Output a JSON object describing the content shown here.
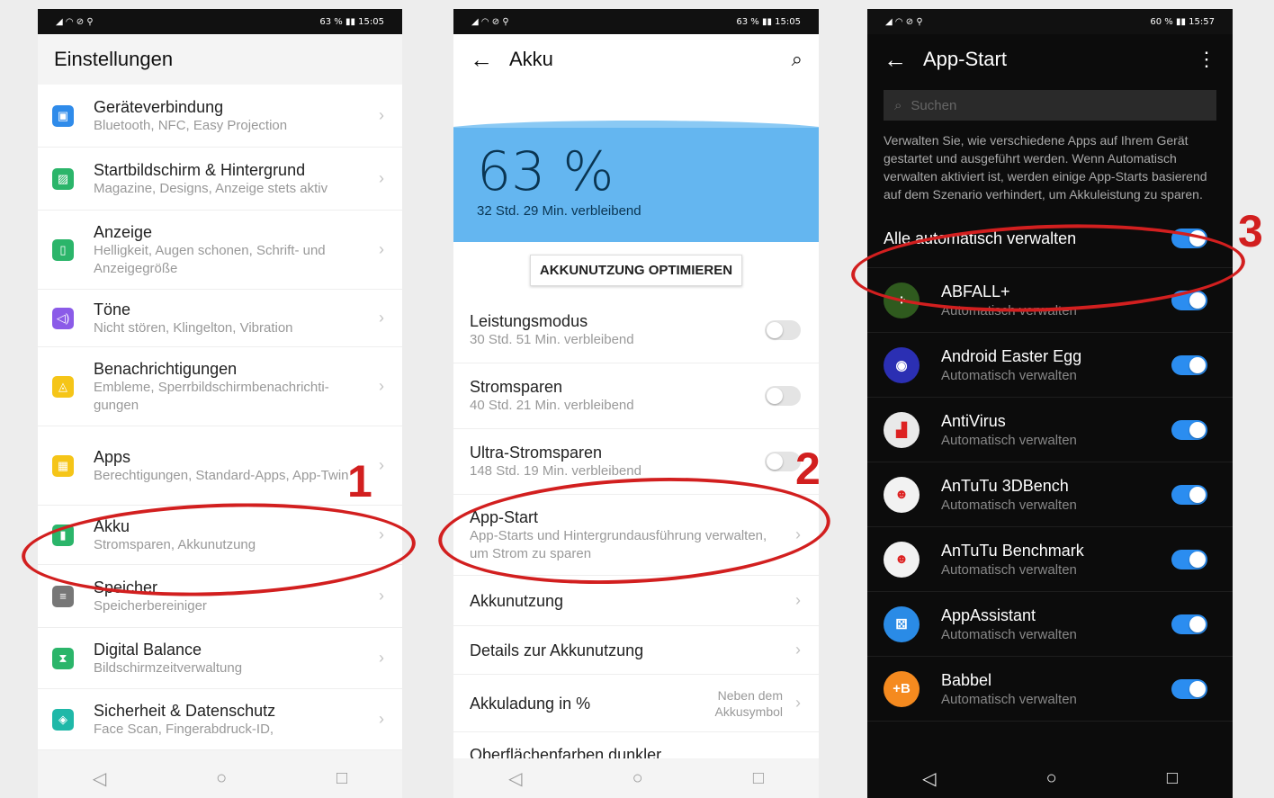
{
  "phone1": {
    "status_left": "◢ ◠ ⊘ ⚲",
    "status_right": "63 % ▮▮ 15:05",
    "title": "Einstellungen",
    "items": [
      {
        "icon": "device-connection-icon",
        "color": "#2f8bea",
        "glyph": "▣",
        "title": "Geräteverbindung",
        "subtitle": "Bluetooth, NFC, Easy Projection"
      },
      {
        "icon": "home-screen-icon",
        "color": "#2bb56a",
        "glyph": "▨",
        "title": "Startbildschirm & Hintergrund",
        "subtitle": "Magazine, Designs, Anzeige stets aktiv"
      },
      {
        "icon": "display-icon",
        "color": "#2bb56a",
        "glyph": "▯",
        "title": "Anzeige",
        "subtitle": "Helligkeit, Augen schonen, Schrift- und Anzeigegröße"
      },
      {
        "icon": "sound-icon",
        "color": "#8b5be8",
        "glyph": "◁)",
        "title": "Töne",
        "subtitle": "Nicht stören, Klingelton, Vibration"
      },
      {
        "icon": "notifications-icon",
        "color": "#f5c518",
        "glyph": "◬",
        "title": "Benachrichtigungen",
        "subtitle": "Embleme, Sperrbildschirmbenachrichti-gungen"
      },
      {
        "icon": "apps-icon",
        "color": "#f5c518",
        "glyph": "▦",
        "title": "Apps",
        "subtitle": "Berechtigungen, Standard-Apps, App-Twin"
      },
      {
        "icon": "battery-icon",
        "color": "#2bb56a",
        "glyph": "▮",
        "title": "Akku",
        "subtitle": "Stromsparen, Akkunutzung"
      },
      {
        "icon": "storage-icon",
        "color": "#777777",
        "glyph": "≡",
        "title": "Speicher",
        "subtitle": "Speicherbereiniger"
      },
      {
        "icon": "digital-balance-icon",
        "color": "#2bb56a",
        "glyph": "⧗",
        "title": "Digital Balance",
        "subtitle": "Bildschirmzeitverwaltung"
      },
      {
        "icon": "security-icon",
        "color": "#1fb8a8",
        "glyph": "◈",
        "title": "Sicherheit & Datenschutz",
        "subtitle": "Face Scan, Fingerabdruck-ID,"
      }
    ],
    "annotation": "1"
  },
  "phone2": {
    "status_left": "◢ ◠ ⊘ ⚲",
    "status_right": "63 % ▮▮ 15:05",
    "title": "Akku",
    "battery_percent": "63 %",
    "remaining": "32 Std. 29 Min. verbleibend",
    "optimize_button": "AKKUNUTZUNG OPTIMIEREN",
    "modes": [
      {
        "title": "Leistungsmodus",
        "subtitle": "30 Std. 51 Min. verbleibend",
        "on": false
      },
      {
        "title": "Stromsparen",
        "subtitle": "40 Std. 21 Min. verbleibend",
        "on": false
      },
      {
        "title": "Ultra-Stromsparen",
        "subtitle": "148 Std. 19 Min. verbleibend",
        "on": false
      }
    ],
    "app_start": {
      "title": "App-Start",
      "subtitle": "App-Starts und Hintergrundausführung verwalten, um Strom zu sparen"
    },
    "usage": "Akkunutzung",
    "usage_details": "Details zur Akkunutzung",
    "charge_pct": {
      "title": "Akkuladung in %",
      "value": "Neben dem Akkusymbol"
    },
    "dark_colors": "Oberflächenfarben dunkler",
    "annotation": "2"
  },
  "phone3": {
    "status_left": "◢ ◠ ⊘ ⚲",
    "status_right": "60 % ▮▮ 15:57",
    "title": "App-Start",
    "search_placeholder": "Suchen",
    "description": "Verwalten Sie, wie verschiedene Apps auf Ihrem Gerät gestartet und ausgeführt werden. Wenn Automatisch verwalten aktiviert ist, werden einige App-Starts basierend auf dem Szenario verhindert, um Akkuleistung zu sparen.",
    "manage_all": "Alle automatisch verwalten",
    "manage_all_on": true,
    "apps": [
      {
        "name": "ABFALL+",
        "status": "Automatisch verwalten",
        "color": "#2f5a1e",
        "glyph": "⁘",
        "on": true
      },
      {
        "name": "Android Easter Egg",
        "status": "Automatisch verwalten",
        "color": "#2b2fb3",
        "glyph": "◉",
        "on": true
      },
      {
        "name": "AntiVirus",
        "status": "Automatisch verwalten",
        "color": "#e9e9e9",
        "glyph": "▟",
        "on": true
      },
      {
        "name": "AnTuTu 3DBench",
        "status": "Automatisch verwalten",
        "color": "#f2f2f2",
        "glyph": "☻",
        "on": true
      },
      {
        "name": "AnTuTu Benchmark",
        "status": "Automatisch verwalten",
        "color": "#f2f2f2",
        "glyph": "☻",
        "on": true
      },
      {
        "name": "AppAssistant",
        "status": "Automatisch verwalten",
        "color": "#2a8be6",
        "glyph": "⚄",
        "on": true
      },
      {
        "name": "Babbel",
        "status": "Automatisch verwalten",
        "color": "#f58a1f",
        "glyph": "+B",
        "on": true
      }
    ],
    "annotation": "3"
  },
  "nav": {
    "back": "◁",
    "home": "○",
    "recent": "□"
  }
}
